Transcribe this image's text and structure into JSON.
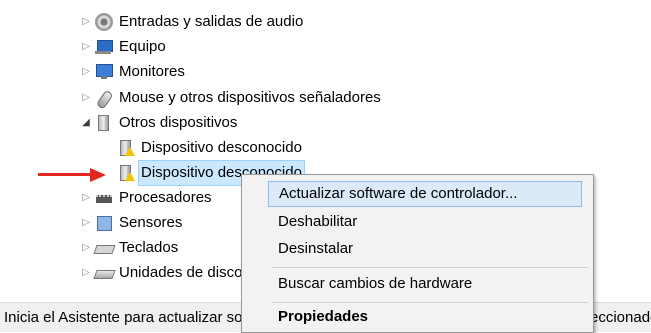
{
  "tree": {
    "items": [
      {
        "label": "Entradas y salidas de audio",
        "icon": "audio-speaker-icon",
        "state": "collapsed"
      },
      {
        "label": "Equipo",
        "icon": "computer-icon",
        "state": "collapsed"
      },
      {
        "label": "Monitores",
        "icon": "monitor-icon",
        "state": "collapsed"
      },
      {
        "label": "Mouse y otros dispositivos señaladores",
        "icon": "mouse-icon",
        "state": "collapsed"
      },
      {
        "label": "Otros dispositivos",
        "icon": "other-devices-icon",
        "state": "expanded"
      },
      {
        "label": "Dispositivo desconocido",
        "icon": "unknown-device-warning-icon"
      },
      {
        "label": "Dispositivo desconocido",
        "icon": "unknown-device-warning-icon",
        "selected": true
      },
      {
        "label": "Procesadores",
        "icon": "processor-icon",
        "state": "collapsed"
      },
      {
        "label": "Sensores",
        "icon": "sensor-icon",
        "state": "collapsed"
      },
      {
        "label": "Teclados",
        "icon": "keyboard-icon",
        "state": "collapsed"
      },
      {
        "label": "Unidades de disco",
        "icon": "disk-drive-icon",
        "state": "collapsed"
      }
    ],
    "toggle_collapsed": "▷",
    "toggle_expanded": "◢"
  },
  "status_bar": {
    "left_text": "Inicia el Asistente para actualizar software de controlador para el dispositivo seleccionado.",
    "right_text": "eccionado"
  },
  "context_menu": {
    "items": [
      {
        "label": "Actualizar software de controlador...",
        "highlighted": true
      },
      {
        "label": "Deshabilitar"
      },
      {
        "label": "Desinstalar"
      },
      {
        "label": "Buscar cambios de hardware"
      },
      {
        "label": "Propiedades",
        "bold": true
      }
    ]
  },
  "colors": {
    "selection": "#cce8ff",
    "menu_highlight": "#dbe9f9",
    "arrow": "#e2261d"
  }
}
